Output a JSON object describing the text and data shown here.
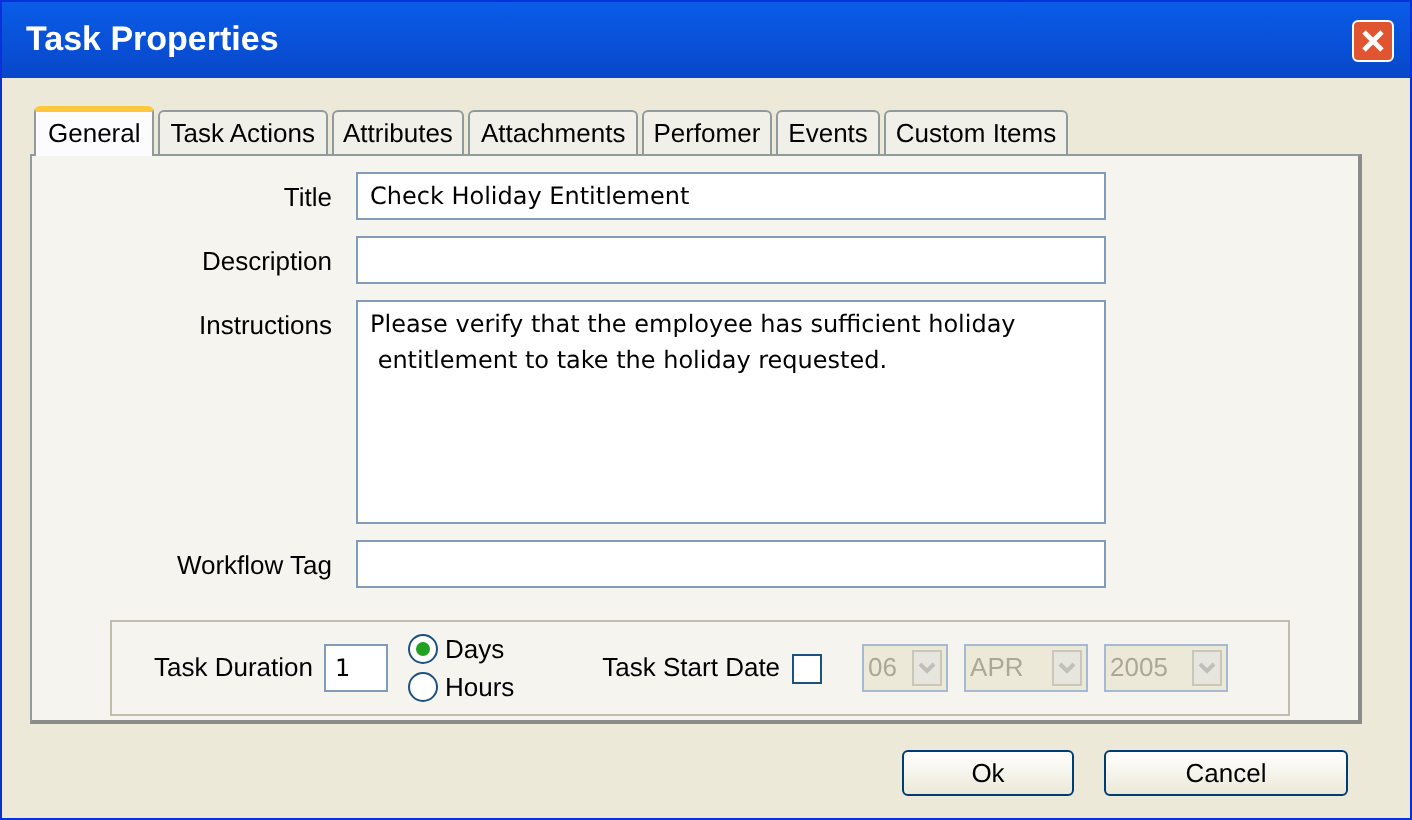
{
  "window": {
    "title": "Task Properties"
  },
  "tabs": [
    {
      "label": "General",
      "selected": true
    },
    {
      "label": "Task Actions",
      "selected": false
    },
    {
      "label": "Attributes",
      "selected": false
    },
    {
      "label": "Attachments",
      "selected": false
    },
    {
      "label": "Perfomer",
      "selected": false
    },
    {
      "label": "Events",
      "selected": false
    },
    {
      "label": "Custom Items",
      "selected": false
    }
  ],
  "fields": [
    {
      "label": "Title",
      "kind": "line",
      "value": "Check Holiday Entitlement"
    },
    {
      "label": "Description",
      "kind": "line"
    },
    {
      "label": "Instructions",
      "kind": "area",
      "value": "Please verify that the employee has sufficient holiday\n entitlement to take the holiday requested."
    },
    {
      "label": "Workflow Tag",
      "kind": "line"
    }
  ],
  "duration": {
    "label": "Task Duration",
    "value": "1",
    "units": [
      {
        "label": "Days",
        "selected": true
      },
      {
        "label": "Hours",
        "selected": false
      }
    ]
  },
  "start_date": {
    "label": "Task Start Date",
    "checked": false,
    "selects": [
      {
        "value": "06",
        "disabled": true
      },
      {
        "value": "APR",
        "disabled": true
      },
      {
        "value": "2005",
        "disabled": true
      }
    ]
  },
  "buttons": [
    "Ok",
    "Cancel"
  ]
}
